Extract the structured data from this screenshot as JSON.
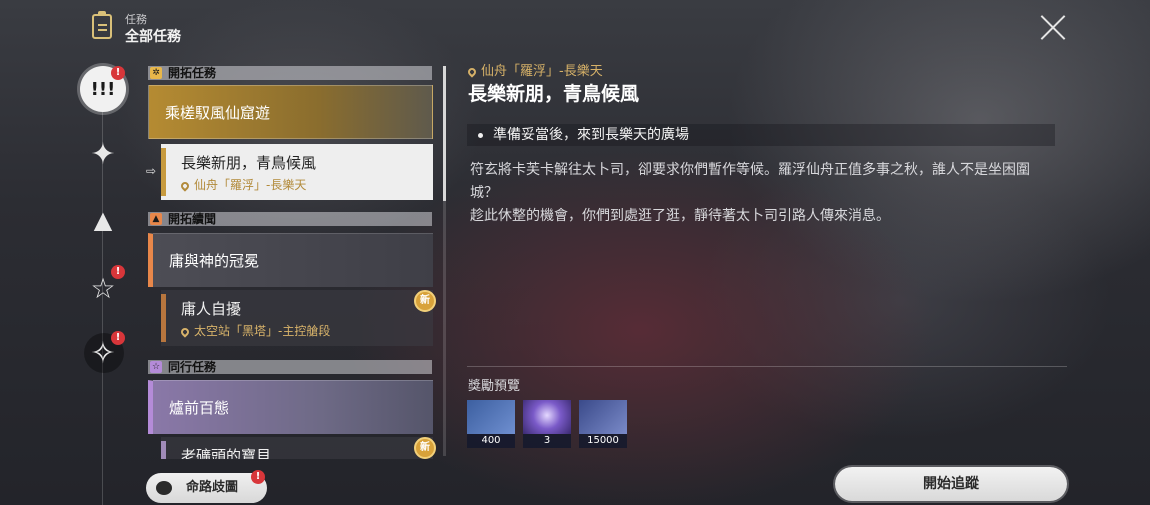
{
  "header": {
    "subtitle": "任務",
    "title": "全部任務"
  },
  "rail": {
    "items": [
      {
        "icon": "all-quests-icon",
        "glyph": "!!!",
        "badge": "!"
      },
      {
        "icon": "trailblaze-star-icon",
        "glyph": "✦",
        "badge": ""
      },
      {
        "icon": "triangle-star-icon",
        "glyph": "▲",
        "badge": ""
      },
      {
        "icon": "companion-star-icon",
        "glyph": "☆",
        "badge": "!"
      },
      {
        "icon": "adventure-star-icon",
        "glyph": "✧",
        "badge": "!"
      }
    ]
  },
  "quest_list": {
    "categories": [
      {
        "label": "開拓任務",
        "color": "#e8b74a"
      },
      {
        "label": "開拓續聞",
        "color": "#e8874a"
      },
      {
        "label": "同行任務",
        "color": "#b48bd8"
      }
    ],
    "items": [
      {
        "title": "乘槎馭風仙窟遊",
        "location": ""
      },
      {
        "title": "長樂新朋，青鳥候風",
        "location": "仙舟「羅浮」-長樂天"
      },
      {
        "title": "庸與神的冠冕",
        "location": ""
      },
      {
        "title": "庸人自擾",
        "location": "太空站「黑塔」-主控艙段",
        "new": "新"
      },
      {
        "title": "爐前百態",
        "location": ""
      },
      {
        "title": "老礦頭的寶貝",
        "location": "",
        "new": "新"
      }
    ]
  },
  "detail": {
    "location": "仙舟「羅浮」-長樂天",
    "title": "長樂新朋，青鳥候風",
    "objective": "準備妥當後，來到長樂天的廣場",
    "description": [
      "符玄將卡芙卡解往太卜司，卻要求你們暫作等候。羅浮仙舟正值多事之秋，誰人不是坐困圍",
      "城？",
      "趁此休整的機會，你們到處逛了逛，靜待著太卜司引路人傳來消息。"
    ],
    "rewards_label": "獎勵預覽",
    "rewards": [
      {
        "name": "trailblaze-exp-icon",
        "qty": "400"
      },
      {
        "name": "stellar-jade-icon",
        "qty": "3"
      },
      {
        "name": "credit-icon",
        "qty": "15000"
      }
    ]
  },
  "buttons": {
    "track": "開始追蹤",
    "paths": "命路歧圖",
    "paths_badge": "!"
  }
}
